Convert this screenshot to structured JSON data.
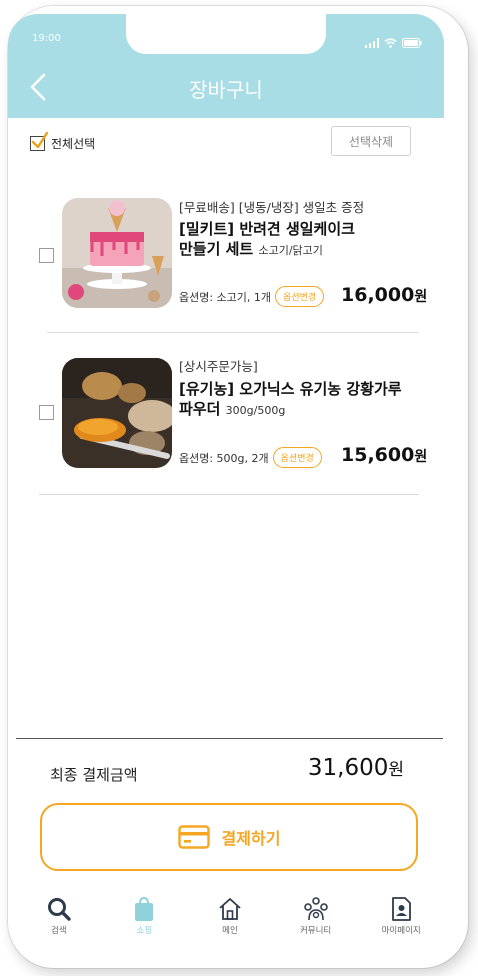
{
  "status_bar": {
    "time": "19:00"
  },
  "header": {
    "title": "장바구니"
  },
  "toolbar": {
    "select_all_label": "전체선택",
    "delete_label": "선택삭제"
  },
  "items": [
    {
      "tag": "[무료배송] [냉동/냉장] 생일초 증정",
      "name_line1": "[밀키트] 반려견 생일케이크",
      "name_line2": "만들기 세트",
      "sub": "소고기/닭고기",
      "option": "옵션명: 소고기, 1개",
      "option_button": "옵션변경",
      "price": "16,000",
      "currency": "원"
    },
    {
      "tag": "[상시주문가능]",
      "name_line1": "[유기농] 오가닉스 유기농 강황가루",
      "name_line2": "파우더",
      "sub": "300g/500g",
      "option": "옵션명: 500g, 2개",
      "option_button": "옵션변경",
      "price": "15,600",
      "currency": "원"
    }
  ],
  "summary": {
    "total_label": "최종 결제금액",
    "total_value": "31,600",
    "currency": "원"
  },
  "pay_button": {
    "label": "결제하기"
  },
  "tabbar": {
    "tabs": [
      {
        "label": "검색",
        "icon": "search-icon"
      },
      {
        "label": "쇼핑",
        "icon": "shopping-bag-icon"
      },
      {
        "label": "메인",
        "icon": "home-icon"
      },
      {
        "label": "커뮤니티",
        "icon": "community-icon"
      },
      {
        "label": "마이페이지",
        "icon": "mypage-icon"
      }
    ],
    "active_index": 1
  },
  "colors": {
    "header": "#a8dde6",
    "accent": "#f5a623",
    "active_tab": "#8fd2dc"
  }
}
